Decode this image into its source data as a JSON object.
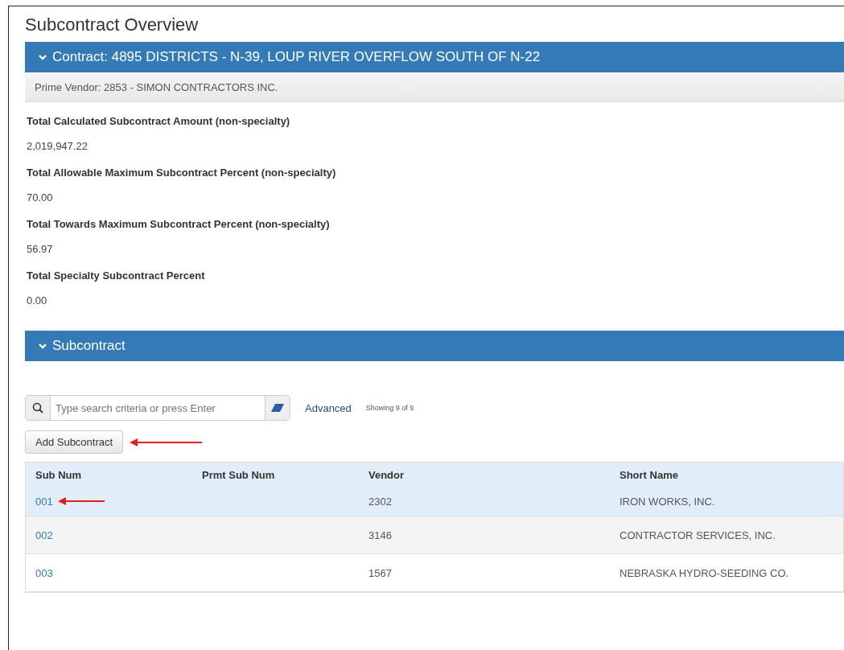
{
  "page_title": "Subcontract Overview",
  "contract_panel": {
    "title": "Contract: 4895 DISTRICTS - N-39, LOUP RIVER OVERFLOW SOUTH OF N-22",
    "expanded": true,
    "prime_vendor": "Prime Vendor: 2853 - SIMON CONTRACTORS INC."
  },
  "fields": [
    {
      "label": "Total Calculated Subcontract Amount (non-specialty)",
      "value": "2,019,947.22"
    },
    {
      "label": "Total Allowable Maximum Subcontract Percent (non-specialty)",
      "value": "70.00"
    },
    {
      "label": "Total Towards Maximum Subcontract Percent (non-specialty)",
      "value": "56.97"
    },
    {
      "label": "Total Specialty Subcontract Percent",
      "value": "0.00"
    }
  ],
  "subcontract_panel": {
    "title": "Subcontract",
    "expanded": true
  },
  "search": {
    "placeholder": "Type search criteria or press Enter"
  },
  "advanced_link": "Advanced",
  "showing": "Showing 9 of 9",
  "add_button": "Add Subcontract",
  "table": {
    "columns": [
      "Sub Num",
      "Prmt Sub Num",
      "Vendor",
      "Short Name"
    ],
    "rows": [
      {
        "selected": true,
        "cells": [
          "001",
          "",
          "2302",
          "IRON WORKS, INC."
        ]
      },
      {
        "selected": false,
        "cells": [
          "002",
          "",
          "3146",
          "CONTRACTOR SERVICES, INC."
        ]
      },
      {
        "selected": false,
        "cells": [
          "003",
          "",
          "1567",
          "NEBRASKA HYDRO-SEEDING CO."
        ]
      }
    ]
  }
}
